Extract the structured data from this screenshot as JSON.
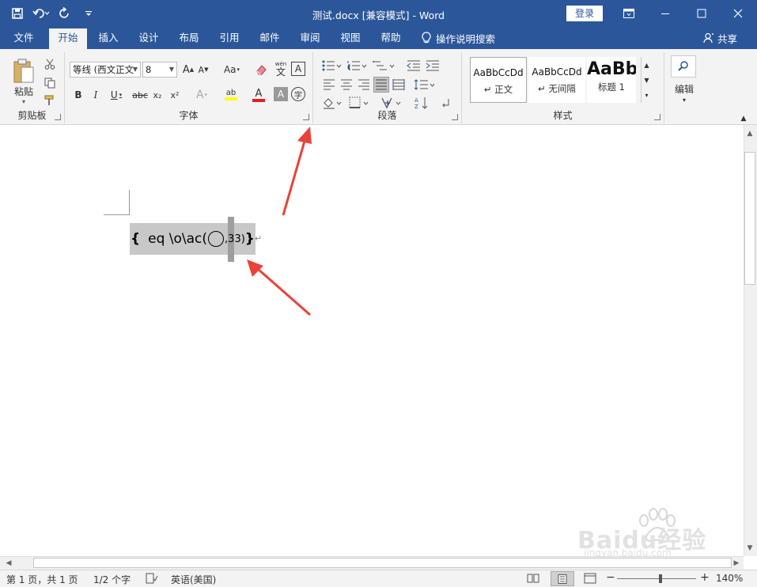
{
  "window": {
    "title": "测试.docx [兼容模式] - Word",
    "signin_label": "登录"
  },
  "tabs": [
    {
      "label": "文件"
    },
    {
      "label": "开始"
    },
    {
      "label": "插入"
    },
    {
      "label": "设计"
    },
    {
      "label": "布局"
    },
    {
      "label": "引用"
    },
    {
      "label": "邮件"
    },
    {
      "label": "审阅"
    },
    {
      "label": "视图"
    },
    {
      "label": "帮助"
    }
  ],
  "tell_me": "操作说明搜索",
  "share": "共享",
  "ribbon": {
    "clipboard": {
      "label": "剪贴板",
      "paste_label": "粘贴"
    },
    "font": {
      "label": "字体",
      "font_name": "等线 (西文正文",
      "font_size": "8",
      "bold": "B",
      "italic": "I",
      "underline": "U",
      "strikethrough": "abc",
      "subscript": "x₂",
      "superscript": "x²",
      "grow": "A",
      "shrink": "A",
      "case": "Aa",
      "phonetic": "wén",
      "phonetic_char": "文",
      "border_char": "A",
      "effects": "A",
      "highlight": "ab",
      "font_color": "A",
      "shading": "A",
      "enclose": "字"
    },
    "paragraph": {
      "label": "段落"
    },
    "styles": {
      "label": "样式",
      "items": [
        {
          "sample": "AaBbCcDd",
          "name": "正文"
        },
        {
          "sample": "AaBbCcDd",
          "name": "无间隔"
        },
        {
          "sample": "AaBb",
          "name": "标题 1"
        }
      ]
    },
    "editing": {
      "label": "编辑"
    }
  },
  "document": {
    "field_open": "{",
    "field_code": "eq \\o\\ac(",
    "field_sep": ",",
    "field_selected": "3",
    "field_tail": "3)",
    "field_close": "}",
    "para_mark": "↵"
  },
  "status": {
    "page": "第 1 页，共 1 页",
    "words": "1/2 个字",
    "language": "英语(美国)",
    "zoom": "140%",
    "zoom_minus": "−",
    "zoom_plus": "+"
  },
  "watermark": {
    "brand": "Baidu经验",
    "url": "jingyan.baidu.com"
  },
  "colors": {
    "brand": "#2b579a",
    "arrow": "#e8423a"
  }
}
